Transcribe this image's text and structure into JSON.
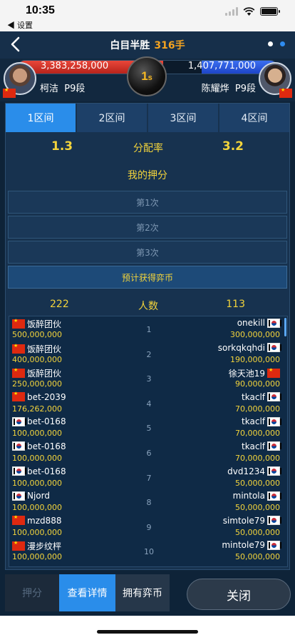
{
  "status": {
    "time": "10:35",
    "back_app": "◀ 设置"
  },
  "header": {
    "title": "白目半胜",
    "moves": "316手"
  },
  "players": {
    "left": {
      "amount": "3,383,258,000",
      "name": "柯洁",
      "rank": "P9段"
    },
    "right": {
      "amount": "1,407,771,000",
      "name": "陈耀烨",
      "rank": "P9段"
    },
    "timer": "1",
    "timer_unit": "s"
  },
  "tabs": [
    "1区间",
    "2区间",
    "3区间",
    "4区间"
  ],
  "rate": {
    "left": "1.3",
    "label": "分配率",
    "right": "3.2"
  },
  "mybet": {
    "title": "我的押分",
    "slots": [
      "第1次",
      "第2次",
      "第3次"
    ],
    "estimate": "预计获得弈币"
  },
  "counts": {
    "left": "222",
    "label": "人数",
    "right": "113"
  },
  "rows": [
    {
      "idx": "1",
      "lname": "饭醉团伙",
      "lflag": "cn",
      "lamt": "500,000,000",
      "rname": "onekill",
      "rflag": "kr",
      "ramt": "300,000,000"
    },
    {
      "idx": "2",
      "lname": "饭醉团伙",
      "lflag": "cn",
      "lamt": "400,000,000",
      "rname": "sorkqkqhdi",
      "rflag": "kr",
      "ramt": "190,000,000"
    },
    {
      "idx": "3",
      "lname": "饭醉团伙",
      "lflag": "cn",
      "lamt": "250,000,000",
      "rname": "徐天池19",
      "rflag": "cn",
      "ramt": "90,000,000"
    },
    {
      "idx": "4",
      "lname": "bet-2039",
      "lflag": "cn",
      "lamt": "176,262,000",
      "rname": "tkaclf",
      "rflag": "kr",
      "ramt": "70,000,000"
    },
    {
      "idx": "5",
      "lname": "bet-0168",
      "lflag": "kr",
      "lamt": "100,000,000",
      "rname": "tkaclf",
      "rflag": "kr",
      "ramt": "70,000,000"
    },
    {
      "idx": "6",
      "lname": "bet-0168",
      "lflag": "kr",
      "lamt": "100,000,000",
      "rname": "tkaclf",
      "rflag": "kr",
      "ramt": "70,000,000"
    },
    {
      "idx": "7",
      "lname": "bet-0168",
      "lflag": "kr",
      "lamt": "100,000,000",
      "rname": "dvd1234",
      "rflag": "kr",
      "ramt": "50,000,000"
    },
    {
      "idx": "8",
      "lname": "Njord",
      "lflag": "kr",
      "lamt": "100,000,000",
      "rname": "mintola",
      "rflag": "kr",
      "ramt": "50,000,000"
    },
    {
      "idx": "9",
      "lname": "mzd888",
      "lflag": "cn",
      "lamt": "100,000,000",
      "rname": "simtole79",
      "rflag": "kr",
      "ramt": "50,000,000"
    },
    {
      "idx": "10",
      "lname": "漫步纹枰",
      "lflag": "cn",
      "lamt": "100,000,000",
      "rname": "mintole79",
      "rflag": "kr",
      "ramt": "50,000,000"
    }
  ],
  "bottom": {
    "score": "押分",
    "detail": "查看详情",
    "coins": "拥有弈币",
    "close": "关闭"
  },
  "colors": {
    "accent": "#2a8dea",
    "gold": "#f3d43b",
    "moves": "#f3a321"
  }
}
